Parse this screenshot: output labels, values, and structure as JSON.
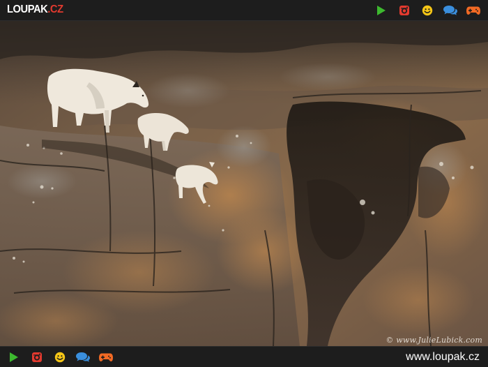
{
  "header": {
    "logo": {
      "name": "LOUPAK",
      "tld": ".CZ"
    },
    "icons": [
      {
        "name": "play-icon",
        "color": "#3db92f"
      },
      {
        "name": "instagram-icon",
        "color": "#e23a2f"
      },
      {
        "name": "smiley-icon",
        "color": "#f5c617"
      },
      {
        "name": "chat-bubbles-icon",
        "color": "#3a8fde"
      },
      {
        "name": "gamepad-icon",
        "color": "#f26a24"
      }
    ]
  },
  "photo": {
    "subject": "mountain-goats-on-cliff",
    "watermark": "© www.JulieLubick.com"
  },
  "footer": {
    "url": "www.loupak.cz"
  }
}
